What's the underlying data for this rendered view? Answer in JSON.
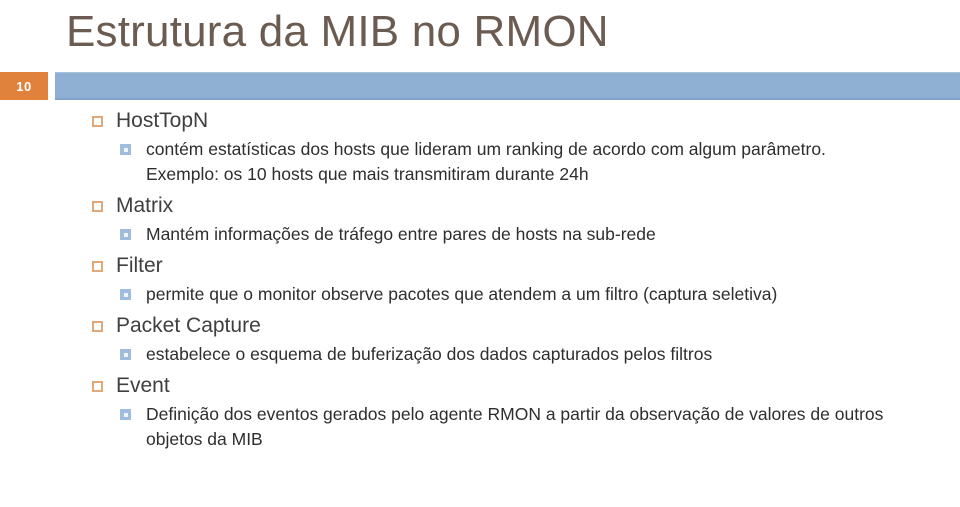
{
  "slide": {
    "title": "Estrutura da MIB no RMON",
    "page_number": "10",
    "colors": {
      "title_text": "#6B5B51",
      "badge_background": "#E0823C",
      "badge_text": "#FFFFFF",
      "header_bar": "#8FB0D3",
      "level1_marker_border": "#E2A878",
      "level2_marker": "#9FBDDC",
      "body_text": "#2E2E2E",
      "background": "#FFFFFF"
    },
    "bullets": [
      {
        "label": "HostTopN",
        "marker": "hollow-square-bullet",
        "children": [
          {
            "text": "contém estatísticas dos hosts que lideram um ranking de acordo com algum parâmetro. Exemplo: os 10 hosts que mais transmitiram durante 24h",
            "marker": "small-square-bullet"
          }
        ]
      },
      {
        "label": "Matrix",
        "marker": "hollow-square-bullet",
        "children": [
          {
            "text": "Mantém informações de tráfego entre pares de hosts na sub-rede",
            "marker": "small-square-bullet"
          }
        ]
      },
      {
        "label": "Filter",
        "marker": "hollow-square-bullet",
        "children": [
          {
            "text": "permite que o monitor observe pacotes que atendem a um filtro (captura seletiva)",
            "marker": "small-square-bullet"
          }
        ]
      },
      {
        "label": "Packet Capture",
        "marker": "hollow-square-bullet",
        "children": [
          {
            "text": "estabelece o esquema de buferização dos dados capturados pelos filtros",
            "marker": "small-square-bullet"
          }
        ]
      },
      {
        "label": "Event",
        "marker": "hollow-square-bullet",
        "children": [
          {
            "text": "Definição dos eventos gerados pelo agente RMON a partir da observação de valores de outros objetos da MIB",
            "marker": "small-square-bullet"
          }
        ]
      }
    ]
  }
}
